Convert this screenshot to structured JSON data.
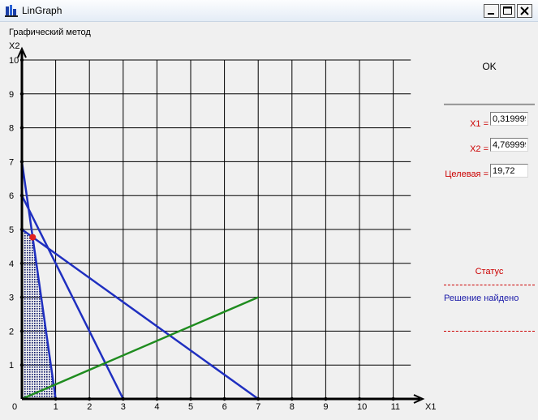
{
  "window": {
    "title": "LinGraph"
  },
  "graph": {
    "method_label": "Графический метод",
    "axis_x_label": "X1",
    "axis_y_label": "X2"
  },
  "controls": {
    "ok_label": "OK",
    "x1_label": "X1 =",
    "x1_value": "0,319999",
    "x2_label": "X2 =",
    "x2_value": "4,769999",
    "objective_label": "Целевая =",
    "objective_value": "19,72"
  },
  "status": {
    "title": "Статус",
    "message": "Решение найдено"
  },
  "chart_data": {
    "type": "line",
    "xlabel": "X1",
    "ylabel": "X2",
    "xlim": [
      0,
      12
    ],
    "ylim": [
      0,
      10
    ],
    "x_ticks": [
      0,
      1,
      2,
      3,
      4,
      5,
      6,
      7,
      8,
      9,
      10,
      11
    ],
    "y_ticks": [
      0,
      1,
      2,
      3,
      4,
      5,
      6,
      7,
      8,
      9,
      10
    ],
    "grid": true,
    "series": [
      {
        "color": "#1f2fc0",
        "points": [
          [
            0,
            7
          ],
          [
            1,
            0
          ]
        ]
      },
      {
        "color": "#1f2fc0",
        "points": [
          [
            0,
            6
          ],
          [
            3,
            0
          ]
        ]
      },
      {
        "color": "#1f2fc0",
        "points": [
          [
            0,
            5
          ],
          [
            7,
            0
          ]
        ]
      },
      {
        "color": "#1f2fc0",
        "points": [
          [
            0,
            0
          ],
          [
            7,
            0
          ]
        ]
      },
      {
        "color": "#1f8c1f",
        "points": [
          [
            0,
            0
          ],
          [
            7,
            3
          ]
        ]
      }
    ],
    "feasible_region": [
      [
        0,
        0
      ],
      [
        0,
        5
      ],
      [
        0.32,
        4.77
      ],
      [
        1,
        0
      ]
    ],
    "optimum": {
      "x": 0.32,
      "y": 4.77,
      "color": "#e02020"
    }
  }
}
